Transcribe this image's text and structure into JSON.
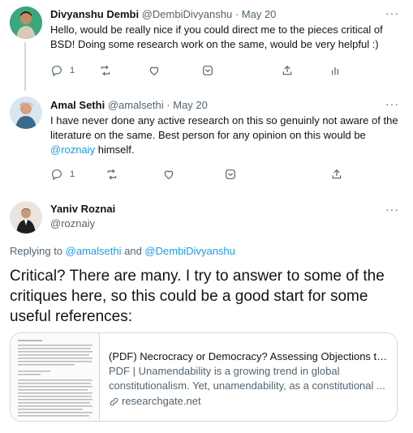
{
  "tweets": [
    {
      "name": "Divyanshu Dembi",
      "handle": "@DembiDivyanshu",
      "dot": "·",
      "date": "May 20",
      "text": "Hello, would be really nice if you could direct me to the pieces critical of BSD! Doing some research work on the same, would be very helpful :)",
      "reply_count": "1"
    },
    {
      "name": "Amal Sethi",
      "handle": "@amalsethi",
      "dot": "·",
      "date": "May 20",
      "text_before": "I have never done any active research on this so genuinly not aware of the literature on the same. Best person for any opinion on this would be ",
      "mention": "@roznaiy",
      "text_after": " himself.",
      "reply_count": "1"
    }
  ],
  "main_tweet": {
    "name": "Yaniv Roznai",
    "handle": "@roznaiy",
    "replying_prefix": "Replying to ",
    "replying_user1": "@amalsethi",
    "replying_and": " and ",
    "replying_user2": "@DembiDivyanshu",
    "text": "Critical? There are many. I try to answer to some of the critiques here, so this could be a good start for some useful references:"
  },
  "link_card": {
    "title": "(PDF) Necrocracy or Democracy? Assessing Objections to C...",
    "description": "PDF | Unamendability is a growing trend in global constitutionalism. Yet, unamendability, as a constitutional ...",
    "domain": "researchgate.net"
  },
  "more_glyph": "···",
  "icons": [
    "reply-icon",
    "retweet-icon",
    "like-icon",
    "bookmark-icon",
    "share-icon",
    "analytics-icon",
    "more-icon",
    "link-icon"
  ]
}
